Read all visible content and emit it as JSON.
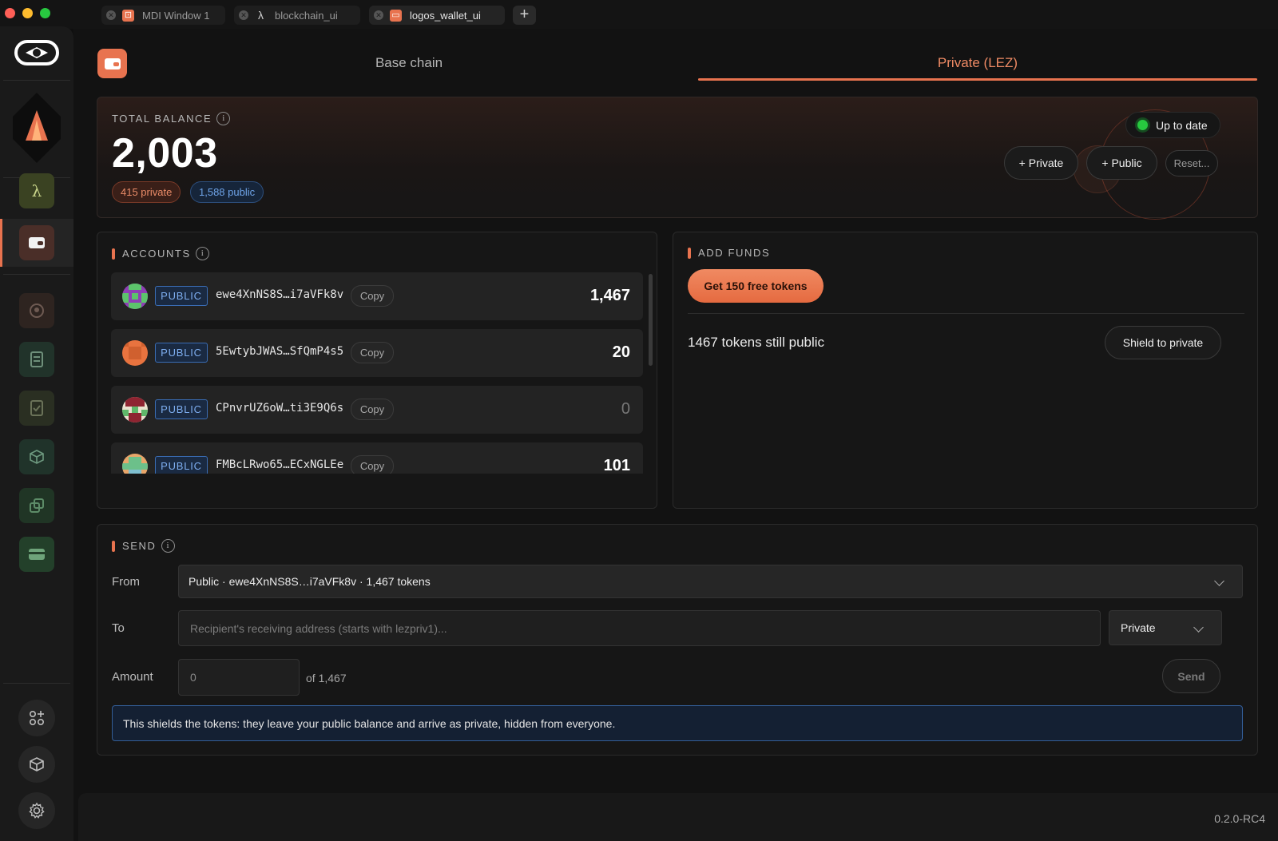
{
  "tabs": [
    {
      "label": "MDI Window 1",
      "icon": "logos-app-icon"
    },
    {
      "label": "blockchain_ui",
      "icon": "lambda-icon"
    },
    {
      "label": "logos_wallet_ui",
      "icon": "wallet-icon"
    }
  ],
  "nav": {
    "base_chain": "Base chain",
    "private": "Private (LEZ)"
  },
  "balance": {
    "label": "TOTAL BALANCE",
    "amount": "2,003",
    "private_pill": "415 private",
    "public_pill": "1,588 public",
    "status": "Up to date",
    "add_private": "+ Private",
    "add_public": "+ Public",
    "reset": "Reset..."
  },
  "accounts": {
    "title": "ACCOUNTS",
    "copy_label": "Copy",
    "items": [
      {
        "type": "PUBLIC",
        "address": "ewe4XnNS8S…i7aVFk8v",
        "balance": "1,467"
      },
      {
        "type": "PUBLIC",
        "address": "5EwtybJWAS…SfQmP4s5",
        "balance": "20"
      },
      {
        "type": "PUBLIC",
        "address": "CPnvrUZ6oW…ti3E9Q6s",
        "balance": "0"
      },
      {
        "type": "PUBLIC",
        "address": "FMBcLRwo65…ECxNGLEe",
        "balance": "101"
      }
    ]
  },
  "funds": {
    "title": "ADD FUNDS",
    "faucet_button": "Get 150 free tokens",
    "public_notice": "1467 tokens still public",
    "shield_button": "Shield to private"
  },
  "send": {
    "title": "SEND",
    "from_label": "From",
    "from_value": "Public · ewe4XnNS8S…i7aVFk8v · 1,467 tokens",
    "to_label": "To",
    "to_placeholder": "Recipient's receiving address (starts with lezpriv1)...",
    "to_mode": "Private",
    "amount_label": "Amount",
    "amount_value": "0",
    "amount_of": "of 1,467",
    "send_button": "Send",
    "notice": "This shields the tokens: they leave your public balance and arrive as private, hidden from everyone."
  },
  "version": "0.2.0-RC4",
  "colors": {
    "accent": "#e8734f",
    "public": "#3a6db5",
    "status_ok": "#27c93f"
  }
}
